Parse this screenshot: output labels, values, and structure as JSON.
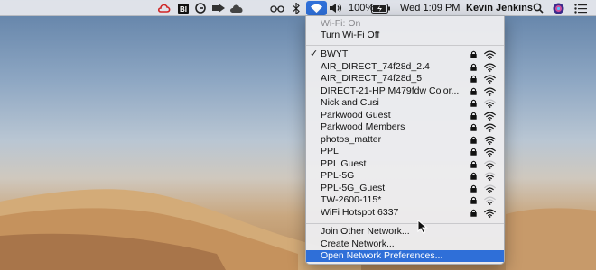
{
  "menubar": {
    "battery_percent": "100%",
    "clock": "Wed 1:09 PM",
    "user": "Kevin Jenkins",
    "status_icons": [
      "creative-cloud-icon",
      "bi-icon",
      "grammarly-icon",
      "arrow-icon",
      "cloud-icon",
      "glasses-icon",
      "bluetooth-icon",
      "wifi-icon",
      "volume-icon",
      "battery-icon",
      "search-icon",
      "siri-icon",
      "list-icon"
    ]
  },
  "wifi_menu": {
    "status": "Wi-Fi: On",
    "toggle": "Turn Wi-Fi Off",
    "networks": [
      {
        "name": "BWYT",
        "connected": true,
        "signal": 3
      },
      {
        "name": "AIR_DIRECT_74f28d_2.4",
        "signal": 3
      },
      {
        "name": "AIR_DIRECT_74f28d_5",
        "signal": 3
      },
      {
        "name": "DIRECT-21-HP M479fdw Color...",
        "signal": 3
      },
      {
        "name": "Nick and Cusi",
        "signal": 2
      },
      {
        "name": "Parkwood Guest",
        "signal": 3
      },
      {
        "name": "Parkwood Members",
        "signal": 3
      },
      {
        "name": "photos_matter",
        "signal": 3
      },
      {
        "name": "PPL",
        "signal": 3
      },
      {
        "name": "PPL Guest",
        "signal": 2
      },
      {
        "name": "PPL-5G",
        "signal": 2
      },
      {
        "name": "PPL-5G_Guest",
        "signal": 2
      },
      {
        "name": "TW-2600-115*",
        "signal": 1
      },
      {
        "name": "WiFi Hotspot 6337",
        "signal": 3
      }
    ],
    "actions": [
      "Join Other Network...",
      "Create Network...",
      "Open Network Preferences..."
    ],
    "selected_action": "Open Network Preferences..."
  },
  "colors": {
    "highlight": "#2f6fd8",
    "menubar": "#e8eaee",
    "menu_bg": "#ececee"
  }
}
